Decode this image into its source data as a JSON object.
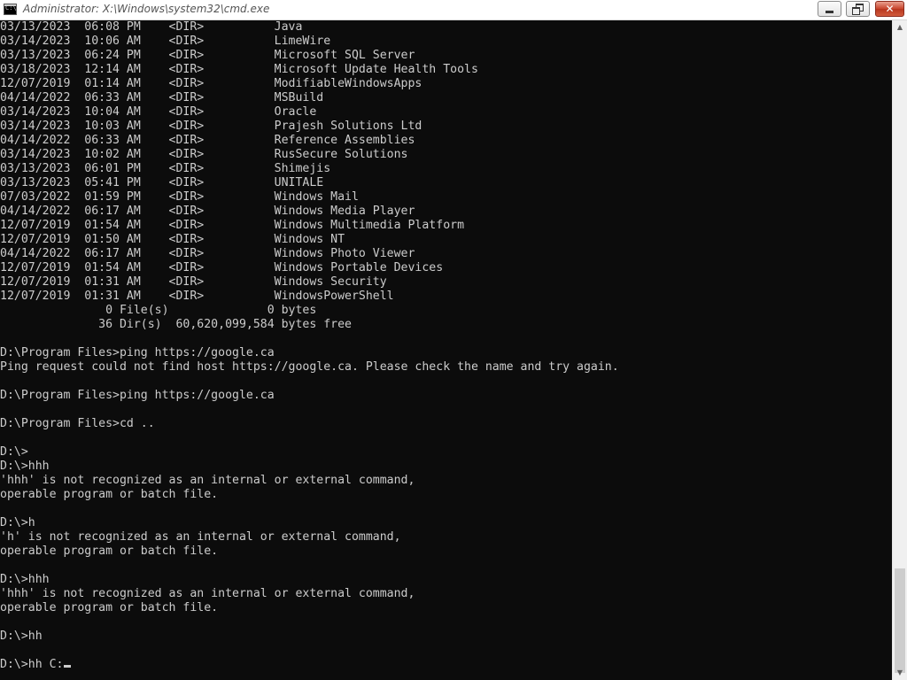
{
  "window": {
    "title": "Administrator: X:\\Windows\\system32\\cmd.exe",
    "icon_label": "C:\\",
    "icon": "cmd-icon",
    "controls": {
      "minimize_icon": "minimize-icon",
      "maximize_icon": "restore-icon",
      "close_icon": "close-icon",
      "close_glyph": "✕"
    }
  },
  "colors": {
    "console_background": "#0c0c0c",
    "console_text": "#cccccc",
    "close_button": "#c8442c"
  },
  "scrollbar": {
    "up_arrow": "▲",
    "down_arrow": "▼"
  },
  "console": {
    "lines": [
      "03/13/2023  06:08 PM    <DIR>          Java",
      "03/14/2023  10:06 AM    <DIR>          LimeWire",
      "03/13/2023  06:24 PM    <DIR>          Microsoft SQL Server",
      "03/18/2023  12:14 AM    <DIR>          Microsoft Update Health Tools",
      "12/07/2019  01:14 AM    <DIR>          ModifiableWindowsApps",
      "04/14/2022  06:33 AM    <DIR>          MSBuild",
      "03/14/2023  10:04 AM    <DIR>          Oracle",
      "03/14/2023  10:03 AM    <DIR>          Prajesh Solutions Ltd",
      "04/14/2022  06:33 AM    <DIR>          Reference Assemblies",
      "03/14/2023  10:02 AM    <DIR>          RusSecure Solutions",
      "03/13/2023  06:01 PM    <DIR>          Shimejis",
      "03/13/2023  05:41 PM    <DIR>          UNITALE",
      "07/03/2022  01:59 PM    <DIR>          Windows Mail",
      "04/14/2022  06:17 AM    <DIR>          Windows Media Player",
      "12/07/2019  01:54 AM    <DIR>          Windows Multimedia Platform",
      "12/07/2019  01:50 AM    <DIR>          Windows NT",
      "04/14/2022  06:17 AM    <DIR>          Windows Photo Viewer",
      "12/07/2019  01:54 AM    <DIR>          Windows Portable Devices",
      "12/07/2019  01:31 AM    <DIR>          Windows Security",
      "12/07/2019  01:31 AM    <DIR>          WindowsPowerShell",
      "               0 File(s)              0 bytes",
      "              36 Dir(s)  60,620,099,584 bytes free",
      "",
      "D:\\Program Files>ping https://google.ca",
      "Ping request could not find host https://google.ca. Please check the name and try again.",
      "",
      "D:\\Program Files>ping https://google.ca",
      "",
      "D:\\Program Files>cd ..",
      "",
      "D:\\>",
      "D:\\>hhh",
      "'hhh' is not recognized as an internal or external command,",
      "operable program or batch file.",
      "",
      "D:\\>h",
      "'h' is not recognized as an internal or external command,",
      "operable program or batch file.",
      "",
      "D:\\>hhh",
      "'hhh' is not recognized as an internal or external command,",
      "operable program or batch file.",
      "",
      "D:\\>hh",
      "",
      "D:\\>hh C:"
    ]
  }
}
